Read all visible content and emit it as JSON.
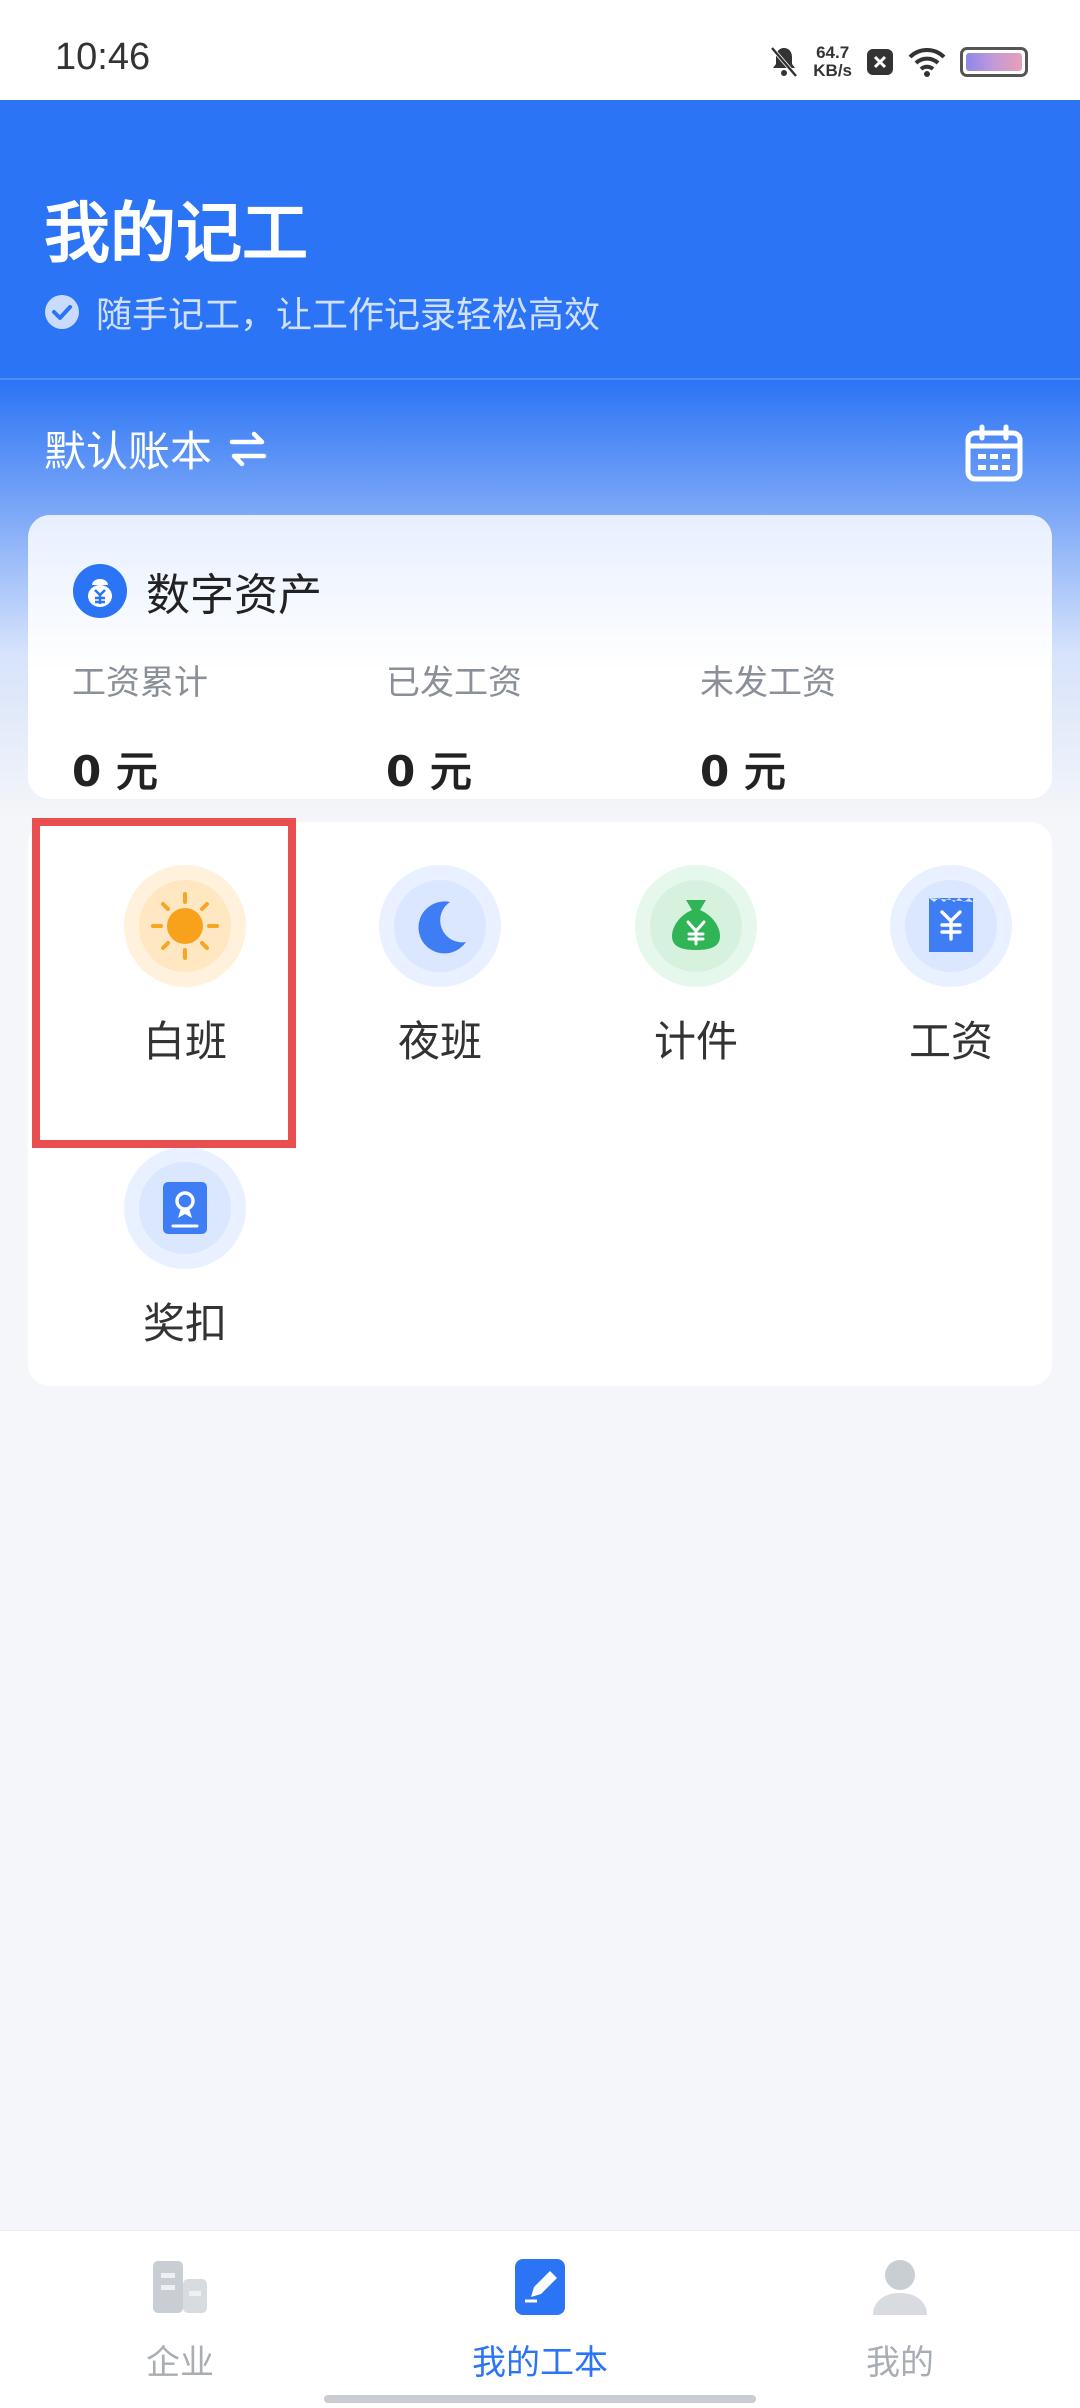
{
  "status_bar": {
    "time": "10:46",
    "net_speed_value": "64.7",
    "net_speed_unit": "KB/s"
  },
  "header": {
    "title": "我的记工",
    "subtitle": "随手记工，让工作记录轻松高效"
  },
  "ledger": {
    "name": "默认账本"
  },
  "assets": {
    "title": "数字资产",
    "stats": [
      {
        "label": "工资累计",
        "value": "0 元"
      },
      {
        "label": "已发工资",
        "value": "0 元"
      },
      {
        "label": "未发工资",
        "value": "0 元"
      }
    ]
  },
  "functions": [
    {
      "label": "白班",
      "icon": "sun-icon"
    },
    {
      "label": "夜班",
      "icon": "moon-icon"
    },
    {
      "label": "计件",
      "icon": "money-bag-icon"
    },
    {
      "label": "工资",
      "icon": "wage-receipt-icon"
    },
    {
      "label": "奖扣",
      "icon": "reward-penalty-icon"
    }
  ],
  "bottom_nav": [
    {
      "label": "企业",
      "icon": "building-icon",
      "active": false
    },
    {
      "label": "我的工本",
      "icon": "edit-note-icon",
      "active": true
    },
    {
      "label": "我的",
      "icon": "person-icon",
      "active": false
    }
  ],
  "colors": {
    "brand_blue": "#2b74f5",
    "highlight_red": "#ea4f4f",
    "sun_orange": "#f6a623",
    "bag_green": "#2fb556"
  }
}
